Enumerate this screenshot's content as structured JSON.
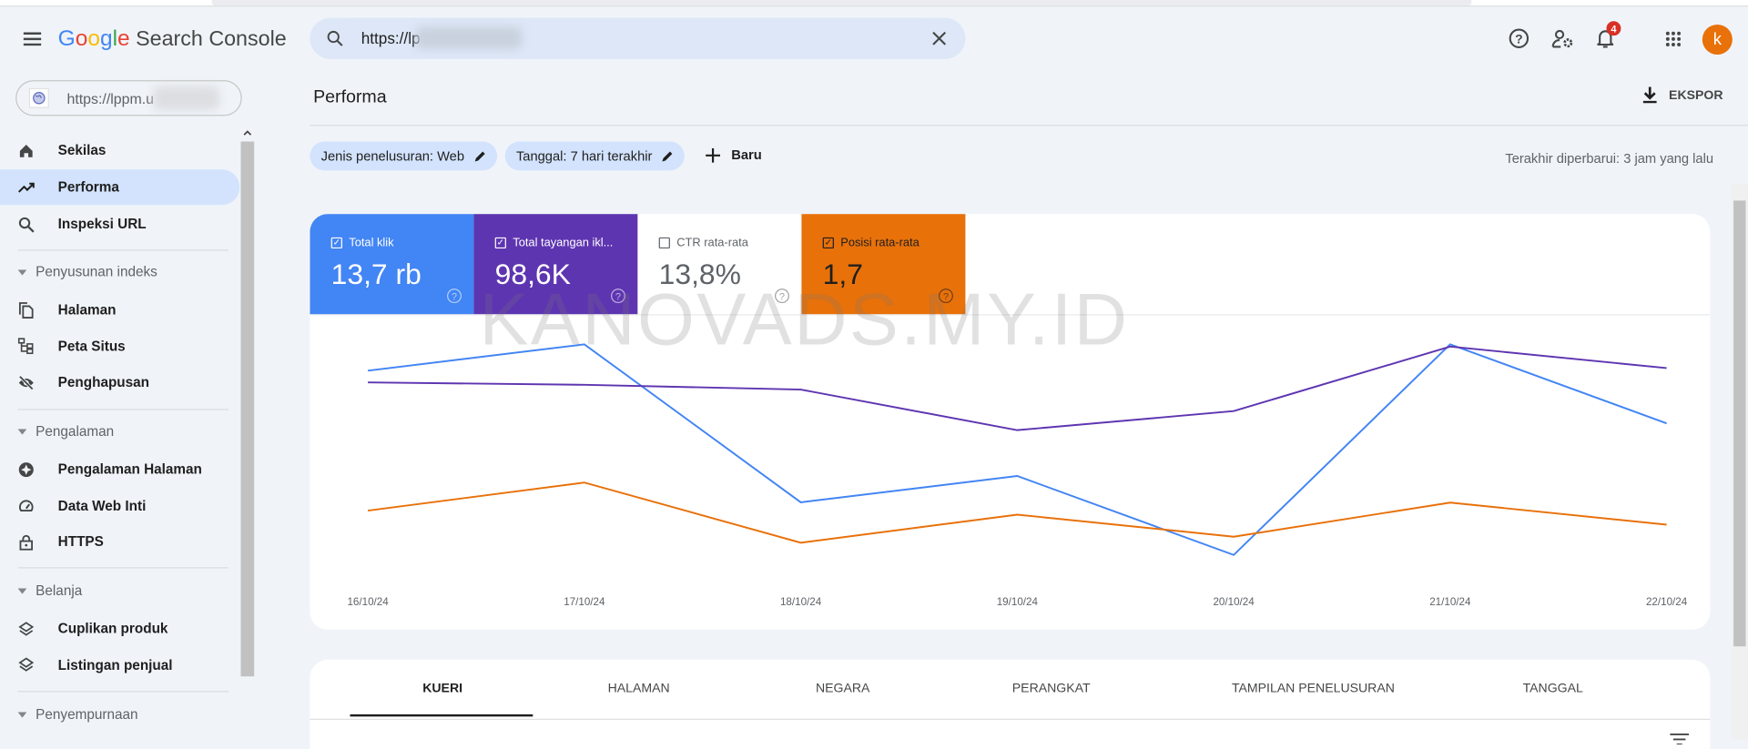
{
  "app": {
    "title": "Google Search Console",
    "logo_google": "Google",
    "logo_product": "Search Console"
  },
  "search": {
    "value": "https://lp",
    "icon": "search-icon",
    "clear_icon": "close-icon"
  },
  "header": {
    "notification_count": "4",
    "avatar_letter": "k",
    "avatar_color": "#e8710a"
  },
  "property": {
    "value": "https://lppm.u"
  },
  "sidebar": {
    "items": [
      {
        "label": "Sekilas",
        "icon": "home-icon"
      },
      {
        "label": "Performa",
        "icon": "trending-up-icon",
        "active": true
      },
      {
        "label": "Inspeksi URL",
        "icon": "search-icon"
      }
    ],
    "sections": [
      {
        "label": "Penyusunan indeks",
        "items": [
          {
            "label": "Halaman",
            "icon": "pages-icon"
          },
          {
            "label": "Peta Situs",
            "icon": "sitemap-icon"
          },
          {
            "label": "Penghapusan",
            "icon": "eye-off-icon"
          }
        ]
      },
      {
        "label": "Pengalaman",
        "items": [
          {
            "label": "Pengalaman Halaman",
            "icon": "page-experience-icon"
          },
          {
            "label": "Data Web Inti",
            "icon": "speedometer-icon"
          },
          {
            "label": "HTTPS",
            "icon": "lock-icon"
          }
        ]
      },
      {
        "label": "Belanja",
        "items": [
          {
            "label": "Cuplikan produk",
            "icon": "layers-icon"
          },
          {
            "label": "Listingan penjual",
            "icon": "layers-icon"
          }
        ]
      },
      {
        "label": "Penyempurnaan",
        "items": []
      }
    ]
  },
  "main": {
    "title": "Performa",
    "export_label": "EKSPOR",
    "filters": [
      "Jenis penelusuran: Web",
      "Tanggal: 7 hari terakhir"
    ],
    "new_label": "Baru",
    "updated": "Terakhir diperbarui: 3 jam yang lalu",
    "watermark": "KANOVADS.MY.ID",
    "metrics": [
      {
        "label": "Total klik",
        "value": "13,7 rb",
        "checked": true,
        "color": "#4285f4"
      },
      {
        "label": "Total tayangan ikl...",
        "value": "98,6K",
        "checked": true,
        "color": "#5e35b1"
      },
      {
        "label": "CTR rata-rata",
        "value": "13,8%",
        "checked": false,
        "color": "#ffffff"
      },
      {
        "label": "Posisi rata-rata",
        "value": "1,7",
        "checked": true,
        "color": "#e8710a"
      }
    ],
    "tabs": [
      "KUERI",
      "HALAMAN",
      "NEGARA",
      "PERANGKAT",
      "TAMPILAN PENELUSURAN",
      "TANGGAL"
    ],
    "active_tab": "KUERI"
  },
  "chart_data": {
    "type": "line",
    "categories": [
      "16/10/24",
      "17/10/24",
      "18/10/24",
      "19/10/24",
      "20/10/24",
      "21/10/24",
      "22/10/24"
    ],
    "series": [
      {
        "name": "Total klik",
        "color": "#4285f4",
        "values": [
          2400,
          2600,
          1400,
          1600,
          1000,
          2600,
          2000
        ]
      },
      {
        "name": "Total tayangan ikl...",
        "color": "#5e35b1",
        "values": [
          14300,
          14200,
          14000,
          12300,
          13100,
          15800,
          14900
        ]
      },
      {
        "name": "Posisi rata-rata",
        "color": "#e8710a",
        "values": [
          1.72,
          1.58,
          1.88,
          1.74,
          1.85,
          1.68,
          1.79
        ],
        "inverted_axis": true
      }
    ],
    "grid": false,
    "y_axis_visible": false
  }
}
